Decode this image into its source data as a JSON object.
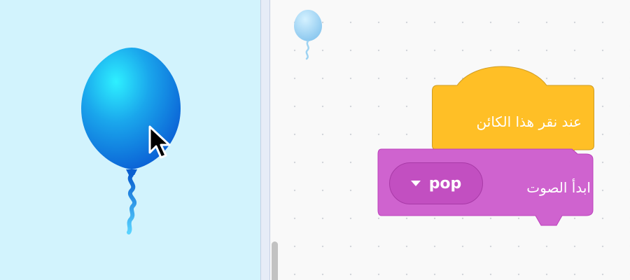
{
  "stage": {
    "sprite_icon": "balloon-sprite",
    "cursor_icon": "mouse-pointer-icon",
    "background_color": "#d2f3fd"
  },
  "code_area": {
    "sprite_thumbnail_icon": "balloon-thumbnail",
    "blocks": {
      "hat": {
        "label": "عند نقر هذا الكائن",
        "color": "#ffbf26"
      },
      "start_sound": {
        "label": "ابدأ الصوت",
        "color": "#cf63cf",
        "dropdown": {
          "value": "pop",
          "icon": "caret-down-icon"
        }
      }
    }
  }
}
